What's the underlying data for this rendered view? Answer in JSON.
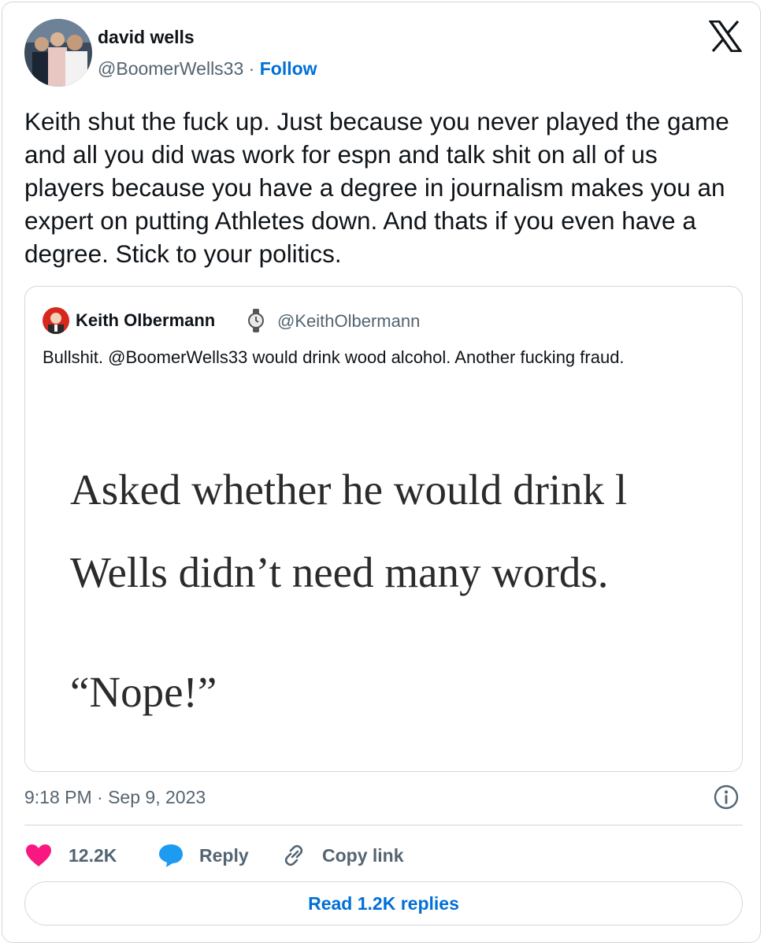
{
  "author": {
    "name": "david wells",
    "handle": "@BoomerWells33",
    "separator": "·",
    "follow_label": "Follow"
  },
  "tweet": {
    "text": "Keith shut the fuck up. Just because you never played the game and all you did was work for espn and talk shit on all of us players because you have a degree in journalism makes you an expert on putting Athletes down. And thats if you even have a degree. Stick to your politics."
  },
  "quote": {
    "name": "Keith Olbermann",
    "handle": "@KeithOlbermann",
    "text": "Bullshit. @BoomerWells33 would drink wood alcohol. Another fucking fraud.",
    "image_lines": [
      "Asked whether he would drink l",
      "Wells didn’t need many words.",
      "“Nope!”"
    ]
  },
  "meta": {
    "timestamp": "9:18 PM · Sep 9, 2023"
  },
  "actions": {
    "likes_count": "12.2K",
    "reply_label": "Reply",
    "copy_link_label": "Copy link"
  },
  "read_replies_label": "Read 1.2K replies",
  "icons": [
    "x-logo",
    "watch-icon",
    "info-icon",
    "heart-icon",
    "reply-bubble-icon",
    "link-icon"
  ],
  "colors": {
    "accent": "#006fd6",
    "heart": "#f91880",
    "secondary": "#536471",
    "border": "#cfd9de"
  }
}
